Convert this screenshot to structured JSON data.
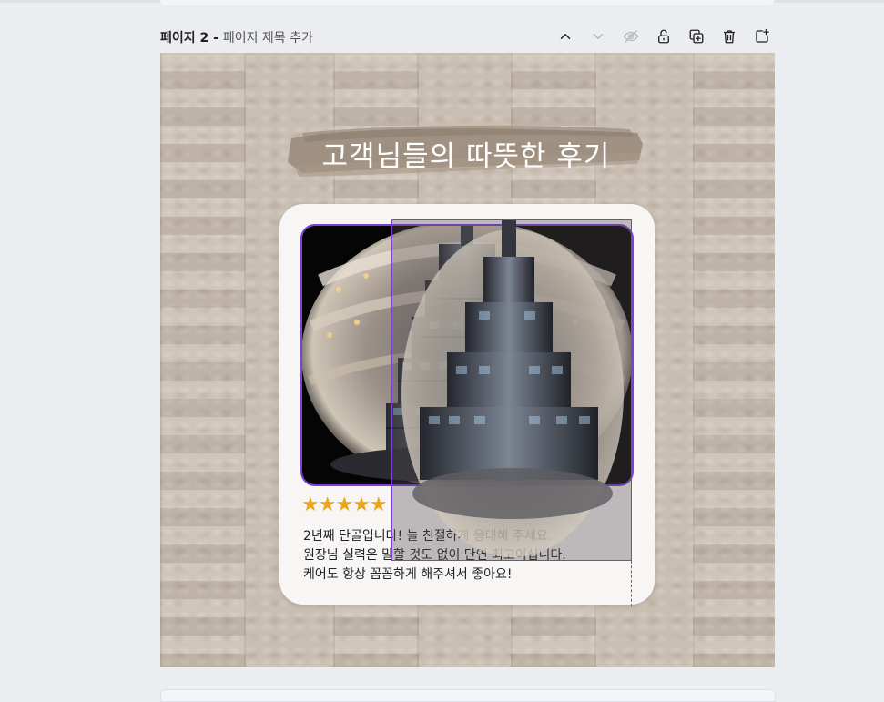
{
  "page_header": {
    "page_number": "페이지 2 - ",
    "title_placeholder": "페이지 제목 추가"
  },
  "toolbar": [
    {
      "name": "move-up",
      "icon": "chevron-up-icon"
    },
    {
      "name": "move-down",
      "icon": "chevron-down-icon"
    },
    {
      "name": "hide",
      "icon": "eye-off-icon"
    },
    {
      "name": "lock",
      "icon": "lock-icon"
    },
    {
      "name": "duplicate",
      "icon": "duplicate-page-icon"
    },
    {
      "name": "delete",
      "icon": "trash-icon"
    },
    {
      "name": "add-page",
      "icon": "add-page-icon"
    }
  ],
  "design": {
    "heading": "고객님들의 따뜻한 후기",
    "rating_stars": 5,
    "stars_text": "★★★★★",
    "review_lines": [
      "2년째 단골입니다! 늘 친절하게 응대해 주세요.",
      "원장님 실력은 말할 것도 없이 단연 최고이십니다.",
      "케어도 항상 꼼꼼하게 해주셔서 좋아요!"
    ]
  },
  "colors": {
    "selection": "#7d3fd4",
    "stars": "#e8a718",
    "background_knit": "#c9beb2",
    "title_brush": "#9a8b7b",
    "card": "#f8f5f5"
  }
}
